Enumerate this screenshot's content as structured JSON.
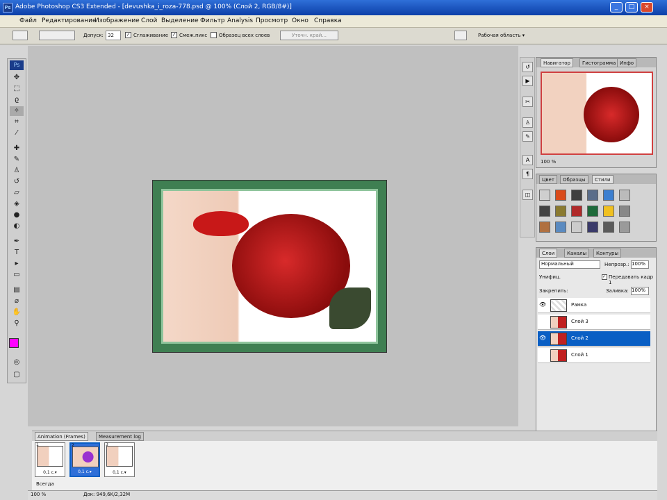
{
  "window": {
    "title": "Adobe Photoshop CS3 Extended - [devushka_i_roza-778.psd @ 100% (Слой 2, RGB/8#)]",
    "app_icon": "Ps"
  },
  "menu": [
    "Файл",
    "Редактирование",
    "Изображение",
    "Слой",
    "Выделение",
    "Фильтр",
    "Analysis",
    "Просмотр",
    "Окно",
    "Справка"
  ],
  "options": {
    "tolerance_label": "Допуск:",
    "tolerance_value": "32",
    "antialias": "Сглаживание",
    "contiguous": "Смеж.пикс",
    "all_layers": "Образец всех слоев",
    "refine": "Уточн. край...",
    "workspace": "Рабочая область ▾"
  },
  "navigator": {
    "tabs": [
      "Навигатор",
      "Гистограмма",
      "Инфо"
    ],
    "zoom": "100 %"
  },
  "styles": {
    "tabs": [
      "Цвет",
      "Образцы",
      "Стили"
    ],
    "swatches": [
      "#cfcfcf",
      "#d94a1a",
      "#3f3f3f",
      "#5a6d8a",
      "#3c7fd0",
      "#bbbbbb",
      "#444444",
      "#8a7a30",
      "#b02a2a",
      "#1e6a3a",
      "#f0c020",
      "#888888",
      "#b07040",
      "#5a8ac0",
      "#cccccc",
      "#3a3a6a",
      "#5a5a5a",
      "#9a9a9a"
    ]
  },
  "layers": {
    "tabs": [
      "Слои",
      "Каналы",
      "Контуры"
    ],
    "blend": "Нормальный",
    "opacity_label": "Непрозр.:",
    "opacity": "100%",
    "unify": "Унифиц.",
    "propagate": "Передавать кадр 1",
    "lock": "Закрепить:",
    "fill_label": "Заливка:",
    "fill": "100%",
    "items": [
      {
        "name": "Рамка",
        "selected": false,
        "visible": true
      },
      {
        "name": "Слой 3",
        "selected": false,
        "visible": false
      },
      {
        "name": "Слой 2",
        "selected": true,
        "visible": true
      },
      {
        "name": "Слой 1",
        "selected": false,
        "visible": false
      }
    ]
  },
  "animation": {
    "tabs": [
      "Animation (Frames)",
      "Measurement log"
    ],
    "frames": [
      {
        "num": "1",
        "time": "0,1 с.▾"
      },
      {
        "num": "2",
        "time": "0,1 с.▾"
      },
      {
        "num": "3",
        "time": "0,1 с.▾"
      }
    ],
    "loop": "Всегда"
  },
  "status": {
    "zoom": "100 %",
    "doc": "Док: 949,6K/2,32M"
  }
}
